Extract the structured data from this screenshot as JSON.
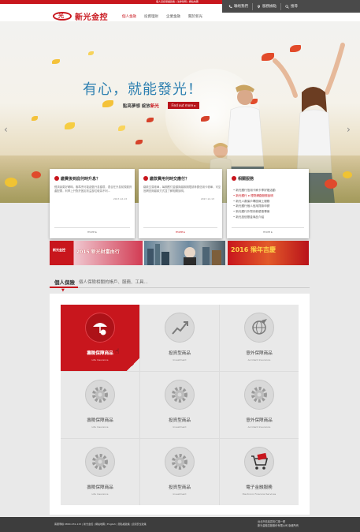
{
  "top_strip": {
    "links": "個人資訊保護政策 | 法律聲明 | 網站地圖"
  },
  "header": {
    "logo_text": "新光金控",
    "nav": [
      {
        "label": "個人金融"
      },
      {
        "label": "投資理財"
      },
      {
        "label": "企業金融"
      },
      {
        "label": "關於新光"
      }
    ],
    "contact_label": "聯絡我們",
    "service_label": "服務據點",
    "search_label": "搜尋"
  },
  "hero": {
    "title": "有心，就能發光！",
    "subtitle_prefix": "點亮夢想 綻放",
    "subtitle_highlight": "新光",
    "button_label": "Find out more ▸"
  },
  "cards": [
    {
      "title": "繳費後到底何時升息？",
      "body": "經濟景氣好轉時，聯準會可能啟動升息循環，適合在升息前規劃資產配置，利率上升對於固定收益部位較為不利...",
      "date": "2017.12.13",
      "more": "more ▸"
    },
    {
      "title": "繳款費用何時交應付？",
      "body": "繳款交易帳單，每期應付金額與繳款期限請參閱信用卡帳單，可至官網查詢繳款方式並了解相關說明。",
      "date": "2017.12.13",
      "more": "more ▸"
    },
    {
      "title": "相關服務",
      "items": [
        "• 新光銀行信用卡刷卡享好禮活動",
        "• 新光銀行 e 理財網路服務說明",
        "• 新光人壽保戶專區線上服務",
        "• 新光銀行個人信用貸款申請",
        "• 新光銀行外幣存款優惠專案",
        "• 新光投信基金商品介紹"
      ],
      "more": "more ▸"
    }
  ],
  "promos": [
    {
      "logo": "新光金控",
      "text": "2015 新光財富由行"
    },
    {
      "text": ""
    },
    {
      "text": "2016 猴年吉慶"
    }
  ],
  "personal": {
    "title": "個人保險",
    "description": "個人保險相關的帳戶、服務、工具...",
    "tiles": [
      {
        "label": "壽險保障商品",
        "sub": "Life Insurance",
        "icon": "umbrella-coin-icon",
        "active": true
      },
      {
        "label": "投資型商品",
        "sub": "Investment",
        "icon": "chart-up-icon",
        "active": false
      },
      {
        "label": "意外保障商品",
        "sub": "Accident Insurance",
        "icon": "globe-plane-icon",
        "active": false
      },
      {
        "label": "壽險保障商品",
        "sub": "Life Insurance",
        "icon": "gear-icon",
        "active": false
      },
      {
        "label": "投資型商品",
        "sub": "Investment",
        "icon": "gear-icon",
        "active": false
      },
      {
        "label": "意外保障商品",
        "sub": "Accident Insurance",
        "icon": "gear-icon",
        "active": false
      },
      {
        "label": "壽險保障商品",
        "sub": "Life Insurance",
        "icon": "gear-icon",
        "active": false
      },
      {
        "label": "投資型商品",
        "sub": "Investment",
        "icon": "gear-icon",
        "active": false
      },
      {
        "label": "電子金融服務",
        "sub": "Electronic Financial Services",
        "icon": "cart-card-icon",
        "active": false
      }
    ]
  },
  "footer": {
    "left": "客服專線 0800-031-115 | 新光金控 | 網站地圖 | English | 隱私權政策 | 資訊安全政策",
    "right_line1": "台北市信義區松仁路一號",
    "right_line2": "新光金融控股股份有限公司 版權所有"
  },
  "colors": {
    "brand_red": "#c8161d",
    "dark_bar": "#4a4a4a",
    "footer": "#3d3d3d",
    "hero_title": "#2c7fb0"
  }
}
